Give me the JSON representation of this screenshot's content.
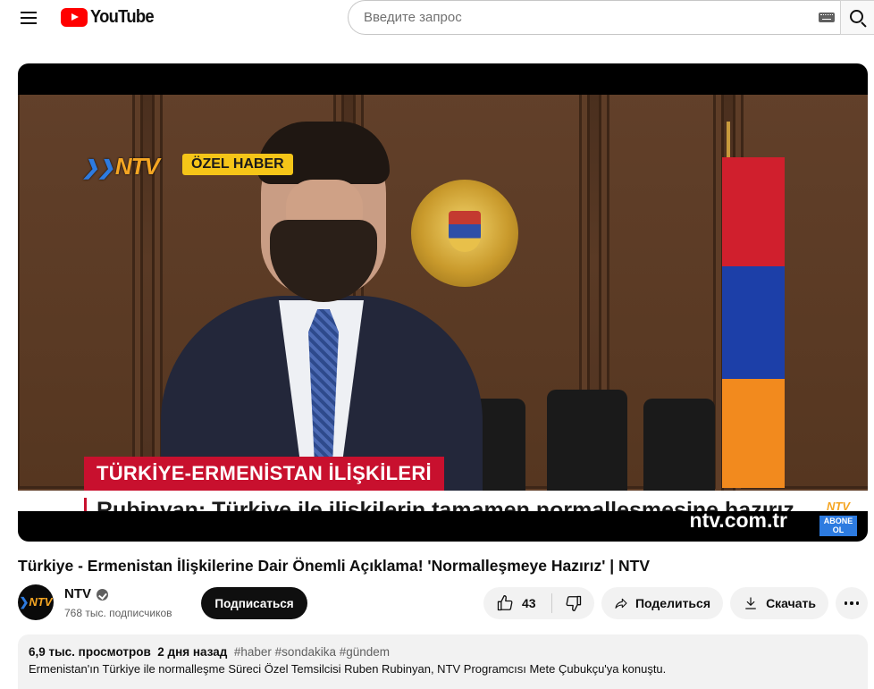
{
  "header": {
    "logo_text": "YouTube",
    "search_placeholder": "Введите запрос"
  },
  "player": {
    "channel_bug": "NTV",
    "badge": "ÖZEL HABER",
    "lower_third_title": "TÜRKİYE-ERMENİSTAN İLİŞKİLERİ",
    "lower_third_text": "Rubinyan: Türkiye ile ilişkilerin tamamen normalleşmesine hazırız",
    "website": "ntv.com.tr",
    "subscribe_bug_logo": "NTV",
    "subscribe_bug_text": "ABONE OL"
  },
  "video": {
    "title": "Türkiye - Ermenistan İlişkilerine Dair Önemli Açıklama! 'Normalleşmeye Hazırız' | NTV"
  },
  "owner": {
    "avatar_text": "NTV",
    "channel_name": "NTV",
    "subscribers": "768 тыс. подписчиков",
    "subscribe_label": "Подписаться"
  },
  "actions": {
    "like_count": "43",
    "share_label": "Поделиться",
    "download_label": "Скачать"
  },
  "description": {
    "views": "6,9 тыс. просмотров",
    "date": "2 дня назад",
    "tags": [
      "#haber",
      "#sondakika",
      "#gündem"
    ],
    "text": "Ermenistan'ın Türkiye ile normalleşme Süreci Özel Temsilcisi Ruben Rubinyan,  NTV Programcısı Mete Çubukçu'ya konuştu."
  },
  "colors": {
    "brand_red": "#ff0000",
    "ntv_orange": "#f5a623",
    "ntv_blue": "#2d7be0",
    "lower_third_red": "#c8102e"
  }
}
